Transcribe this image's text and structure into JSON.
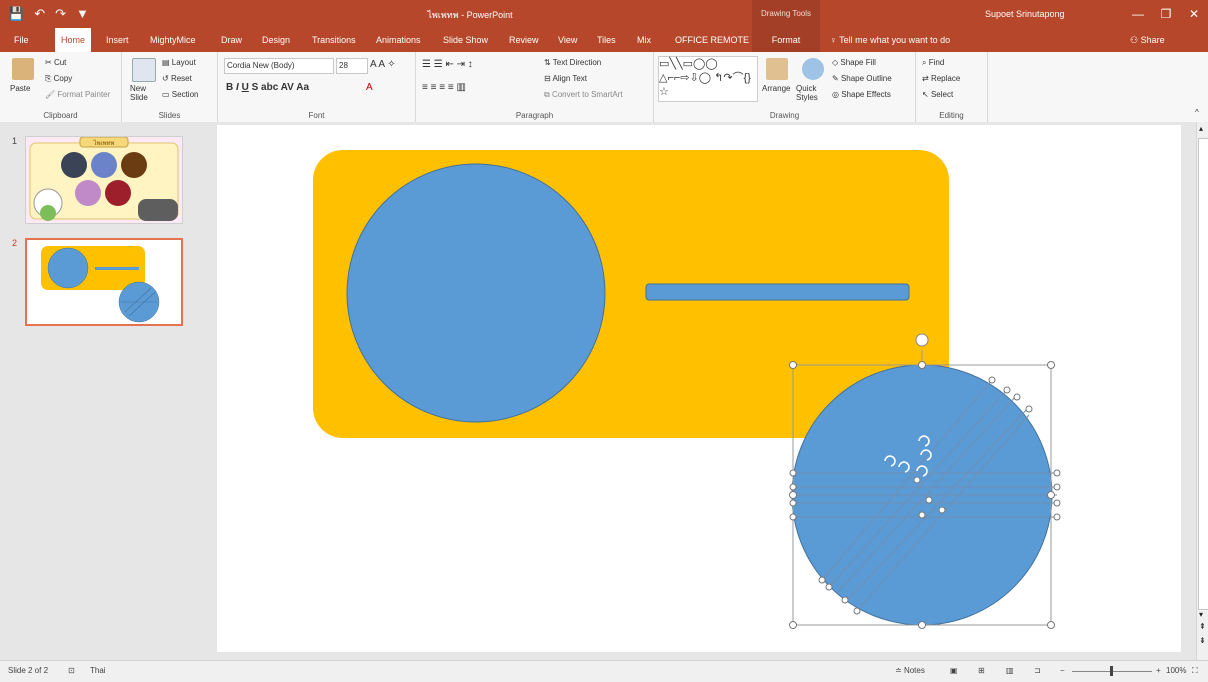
{
  "window": {
    "title": "ไพเพทพ - PowerPoint",
    "context_header": "Drawing Tools",
    "user": "Supoet Srinutapong",
    "minimize": "—",
    "restore": "❐",
    "close": "✕"
  },
  "qat": {
    "save": "💾",
    "undo": "↶",
    "redo": "↷",
    "present": "▼"
  },
  "tabs": [
    "File",
    "Home",
    "Insert",
    "MightyMice",
    "Draw",
    "Design",
    "Transitions",
    "Animations",
    "Slide Show",
    "Review",
    "View",
    "Tiles",
    "Mix",
    "OFFICE REMOTE",
    "Format"
  ],
  "active_tab": "Home",
  "tell_me": "Tell me what you want to do",
  "share": "Share",
  "ribbon": {
    "clipboard": {
      "paste": "Paste",
      "cut": "Cut",
      "copy": "Copy",
      "format_painter": "Format Painter",
      "label": "Clipboard"
    },
    "slides": {
      "new_slide": "New Slide",
      "layout": "Layout",
      "reset": "Reset",
      "section": "Section",
      "label": "Slides"
    },
    "font": {
      "name": "Cordia New (Body)",
      "size": "28",
      "label": "Font"
    },
    "paragraph": {
      "text_direction": "Text Direction",
      "align_text": "Align Text",
      "convert": "Convert to SmartArt",
      "label": "Paragraph"
    },
    "drawing": {
      "arrange": "Arrange",
      "quick_styles": "Quick Styles",
      "shape_fill": "Shape Fill",
      "shape_outline": "Shape Outline",
      "shape_effects": "Shape Effects",
      "label": "Drawing"
    },
    "editing": {
      "find": "Find",
      "replace": "Replace",
      "select": "Select",
      "label": "Editing"
    }
  },
  "thumbnails": [
    {
      "number": "1",
      "title": "ไพเพทพ"
    },
    {
      "number": "2"
    }
  ],
  "colors": {
    "accent": "#b7472a",
    "orange": "#ffc000",
    "blue": "#5b9bd5",
    "selection": "#ed7d31"
  },
  "status": {
    "slide": "Slide 2 of 2",
    "language": "Thai",
    "notes": "Notes",
    "zoom": "100%"
  }
}
